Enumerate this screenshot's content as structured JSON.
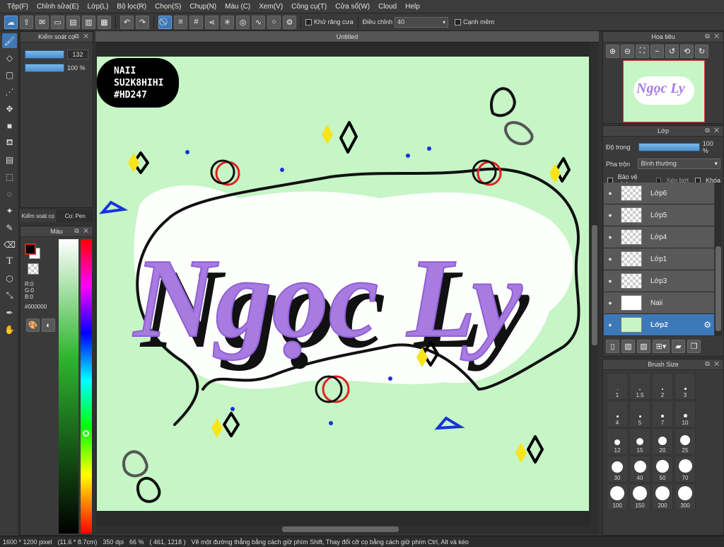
{
  "menu": [
    "Tệp(F)",
    "Chỉnh sửa(E)",
    "Lớp(L)",
    "Bộ lọc(R)",
    "Chọn(S)",
    "Chụp(N)",
    "Màu (C)",
    "Xem(V)",
    "Công cụ(T)",
    "Cửa sổ(W)",
    "Cloud",
    "Help"
  ],
  "toolbar": {
    "antialias_label": "Khử răng cưa",
    "adjust_label": "Điều chỉnh",
    "adjust_value": "40",
    "soft_edge_label": "Cạnh mềm"
  },
  "brush_panel": {
    "title": "Kiểm soát cọ",
    "size_value": "132",
    "opacity_value": "100 %",
    "tab_a": "Kiểm soát cọ",
    "tab_b": "Cọ: Pen"
  },
  "color_panel": {
    "title": "Màu",
    "r": "R:0",
    "g": "G:0",
    "b": "B:0",
    "hex": "#000000"
  },
  "canvas": {
    "tab_title": "Untitled",
    "badge_lines": [
      "NAII",
      "SU2K8HIHI",
      "#HD247"
    ],
    "lettering": "Ngọc Ly"
  },
  "navigator": {
    "title": "Hoa tiêu"
  },
  "layers": {
    "title": "Lớp",
    "opacity_label": "Độ trong",
    "opacity_value": "100 %",
    "blend_label": "Pha trộn",
    "blend_value": "Bình thường",
    "alpha_label": "Bảo vệ alpha",
    "clip_label": "Xén bớt",
    "lock_label": "Khóa",
    "items": [
      "Lớp6",
      "Lớp5",
      "Lớp4",
      "Lớp1",
      "Lớp3",
      "Naii",
      "Lớp2"
    ]
  },
  "brush_size": {
    "title": "Brush Size",
    "sizes": [
      "1",
      "1.5",
      "2",
      "3",
      "4",
      "5",
      "7",
      "10",
      "12",
      "15",
      "20",
      "25",
      "30",
      "40",
      "50",
      "70",
      "100",
      "150",
      "200",
      "300"
    ]
  },
  "status": {
    "size": "1600 * 1200 pixel",
    "cm": "(11.6 * 8.7cm)",
    "dpi": "350 dpi",
    "zoom": "66 %",
    "coords": "( 461, 1218 )",
    "hint": "Vẽ một đường thẳng bằng cách giữ phím Shift, Thay đổi cỡ cọ bằng cách giữ phím Ctrl, Alt và kéo"
  },
  "colors": {
    "accent": "#3d78b8",
    "canvas_bg": "#c6f5c6",
    "lettering": "#a77be0"
  }
}
